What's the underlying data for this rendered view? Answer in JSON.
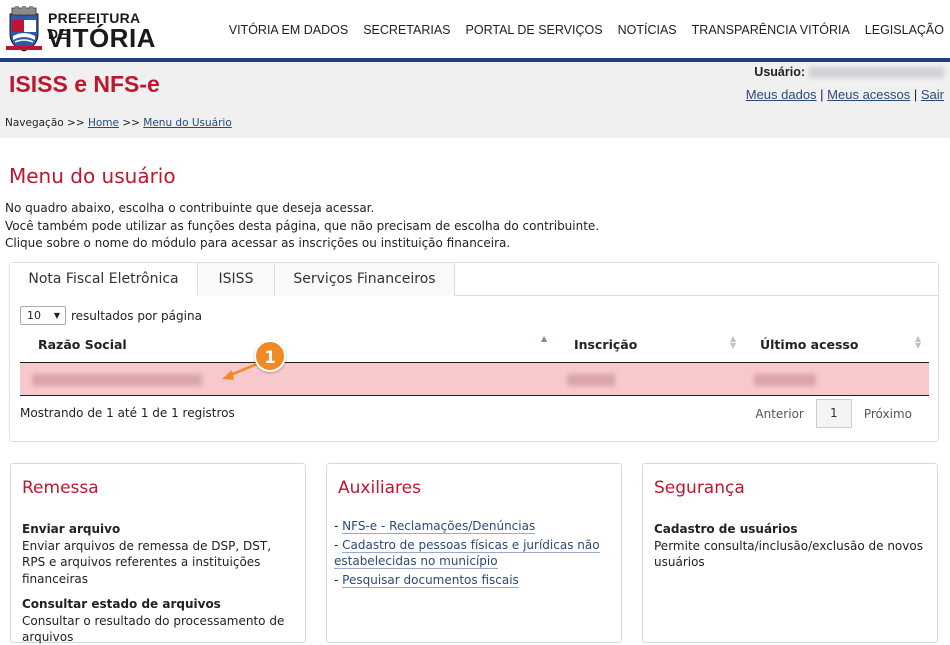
{
  "brand": {
    "line1": "PREFEITURA DE",
    "line2": "VITÓRIA",
    "colors": {
      "red": "#c0152f",
      "blue": "#1f3f7d",
      "highlight_row": "#f7c8cc",
      "marker": "#f08a24"
    }
  },
  "top_nav": [
    "VITÓRIA EM DADOS",
    "SECRETARIAS",
    "PORTAL DE SERVIÇOS",
    "NOTÍCIAS",
    "TRANSPARÊNCIA VITÓRIA",
    "LEGISLAÇÃO"
  ],
  "header": {
    "app_title": "ISISS e NFS-e",
    "user_label": "Usuário:",
    "links": {
      "my_data": "Meus dados",
      "sep1": " | ",
      "my_access": "Meus acessos",
      "sep2": " | ",
      "logout": "Sair"
    }
  },
  "breadcrumb": {
    "label": "Navegação >> ",
    "home": "Home",
    "sep": " >> ",
    "current": "Menu do Usuário"
  },
  "page": {
    "title": "Menu do usuário",
    "intro_1": "No quadro abaixo, escolha o contribuinte que deseja acessar.",
    "intro_2": "Você também pode utilizar as funções desta página, que não precisam de escolha do contribuinte.",
    "intro_3": "Clique sobre o nome do módulo para acessar as inscrições ou instituição financeira."
  },
  "tabs": [
    "Nota Fiscal Eletrônica",
    "ISISS",
    "Serviços Financeiros"
  ],
  "table": {
    "page_length": "10",
    "page_length_label": "resultados por página",
    "columns": [
      "Razão Social",
      "Inscrição",
      "Último acesso"
    ],
    "info": "Mostrando de 1 até 1 de 1 registros",
    "pager": {
      "prev": "Anterior",
      "current": "1",
      "next": "Próximo"
    }
  },
  "marker": {
    "number": "1"
  },
  "cards": {
    "remessa": {
      "title": "Remessa",
      "item1_title": "Enviar arquivo",
      "item1_desc": "Enviar arquivos de remessa de DSP, DST, RPS e arquivos referentes a instituições financeiras",
      "item2_title": "Consultar estado de arquivos",
      "item2_desc": "Consultar o resultado do processamento de arquivos"
    },
    "auxiliares": {
      "title": "Auxiliares",
      "prefix": "- ",
      "link1": "NFS-e - Reclamações/Denúncias",
      "link2": "Cadastro de pessoas físicas e jurídicas não estabelecidas no município",
      "link3": "Pesquisar documentos fiscais"
    },
    "seguranca": {
      "title": "Segurança",
      "item1_title": "Cadastro de usuários",
      "item1_desc": "Permite consulta/inclusão/exclusão de novos usuários"
    }
  }
}
